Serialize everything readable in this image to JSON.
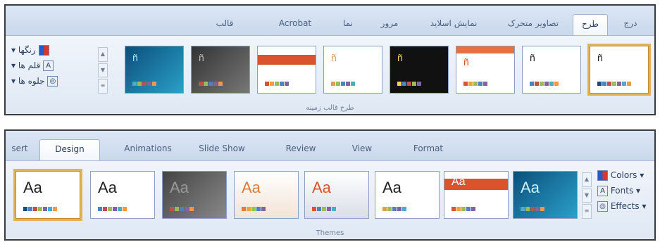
{
  "fa": {
    "tabs": [
      "درج",
      "طرح",
      "تصاویر متحرک",
      "نمایش اسلاید",
      "مرور",
      "نما",
      "Acrobat",
      "قالب"
    ],
    "active_tab": 1,
    "commands": [
      {
        "label": "رنگها",
        "icon": "colors-icon"
      },
      {
        "label": "قلم ها",
        "icon": "fonts-icon"
      },
      {
        "label": "جلوه ها",
        "icon": "effects-icon"
      }
    ],
    "group_label": "طرح قالب زمینه"
  },
  "en": {
    "tabs": [
      "sert",
      "Design",
      "Animations",
      "Slide Show",
      "Review",
      "View",
      "Format"
    ],
    "active_tab": 1,
    "theme_sample": "Aa",
    "commands": [
      {
        "label": "Colors",
        "icon": "colors-icon"
      },
      {
        "label": "Fonts",
        "icon": "fonts-icon"
      },
      {
        "label": "Effects",
        "icon": "effects-icon"
      }
    ],
    "group_label": "Themes"
  },
  "colors": {
    "selection": "#e0b35a",
    "office_orange": "#d9532c",
    "ribbon_bg": "#dde8f5"
  }
}
